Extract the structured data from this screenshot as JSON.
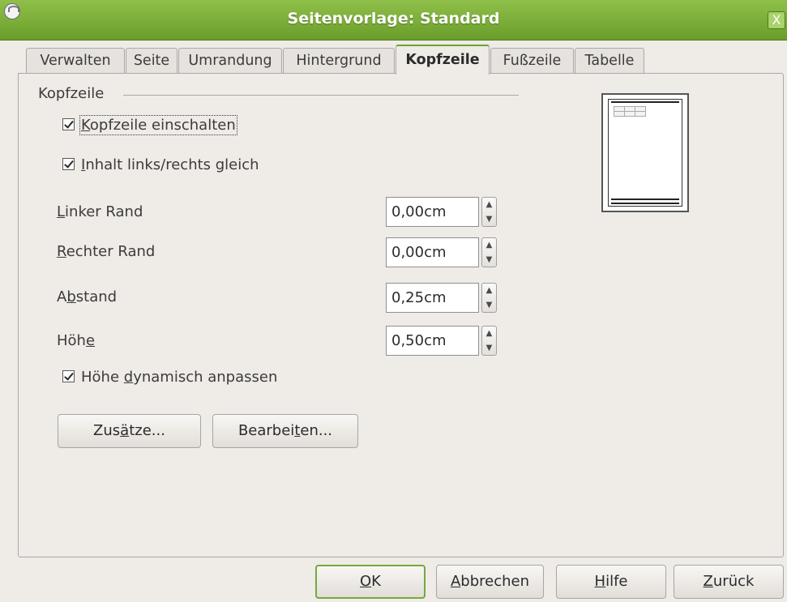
{
  "window": {
    "title": "Seitenvorlage: Standard",
    "close_label": "X"
  },
  "tabs": [
    {
      "label": "Verwalten",
      "active": false
    },
    {
      "label": "Seite",
      "active": false
    },
    {
      "label": "Umrandung",
      "active": false
    },
    {
      "label": "Hintergrund",
      "active": false
    },
    {
      "label": "Kopfzeile",
      "active": true
    },
    {
      "label": "Fußzeile",
      "active": false
    },
    {
      "label": "Tabelle",
      "active": false
    }
  ],
  "kopfzeile": {
    "group_label": "Kopfzeile",
    "checkboxes": {
      "enable": {
        "pre": "",
        "ul": "K",
        "post": "opfzeile einschalten",
        "checked": true
      },
      "same_content": {
        "pre": "",
        "ul": "I",
        "post": "nhalt links/rechts gleich",
        "checked": true
      },
      "dynamic_height": {
        "pre": "Höhe ",
        "ul": "d",
        "post": "ynamisch anpassen",
        "checked": true
      }
    },
    "fields": {
      "left_margin": {
        "pre": "",
        "ul": "L",
        "post": "inker Rand",
        "value": "0,00cm"
      },
      "right_margin": {
        "pre": "",
        "ul": "R",
        "post": "echter Rand",
        "value": "0,00cm"
      },
      "spacing": {
        "pre": "A",
        "ul": "b",
        "post": "stand",
        "value": "0,25cm"
      },
      "height": {
        "pre": "Höh",
        "ul": "e",
        "post": "",
        "value": "0,50cm"
      }
    },
    "buttons": {
      "more": {
        "pre": "Zus",
        "ul": "ä",
        "post": "tze..."
      },
      "edit": {
        "pre": "Bearbei",
        "ul": "t",
        "post": "en..."
      }
    }
  },
  "footer_buttons": {
    "ok": {
      "pre": "",
      "ul": "O",
      "post": "K"
    },
    "cancel": {
      "pre": "",
      "ul": "A",
      "post": "bbrechen"
    },
    "help": {
      "pre": "",
      "ul": "H",
      "post": "ilfe"
    },
    "reset": {
      "pre": "",
      "ul": "Z",
      "post": "urück"
    }
  },
  "colors": {
    "titlebar": "#7aae36",
    "active_tab_accent": "#6aa52b",
    "dialog_bg": "#efebe7"
  },
  "icons": {
    "app": "app-icon",
    "close": "close-icon",
    "spin_up": "chevron-up-icon",
    "spin_down": "chevron-down-icon",
    "preview": "page-preview-icon"
  }
}
